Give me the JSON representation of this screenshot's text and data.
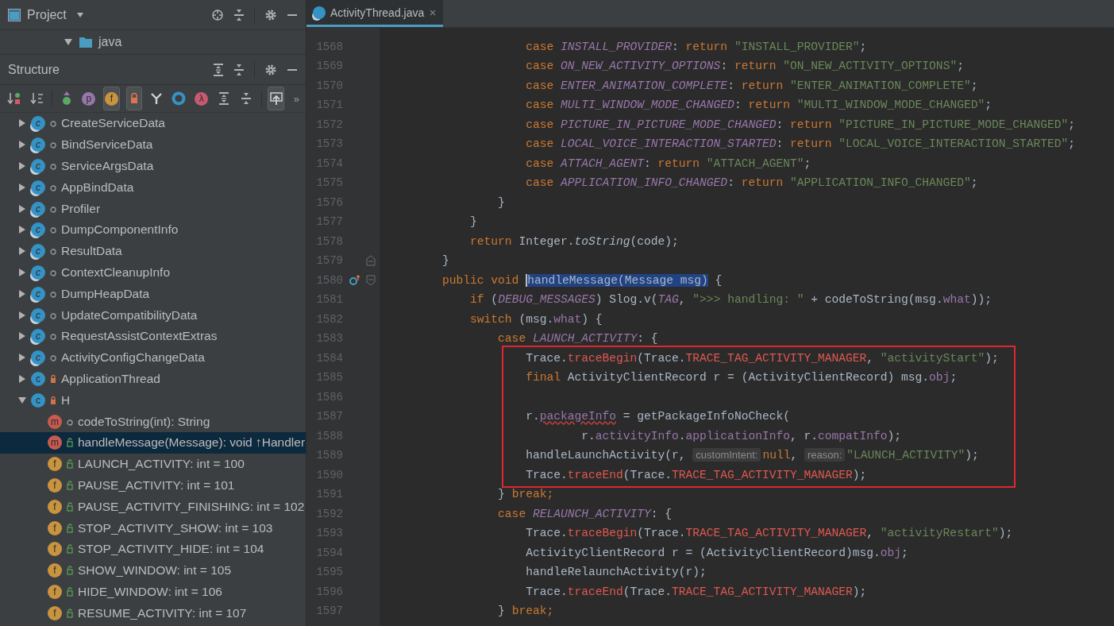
{
  "project_panel": {
    "title": "Project",
    "folder": {
      "label": "java",
      "expanded": true
    }
  },
  "structure_panel": {
    "title": "Structure",
    "overflow": "»",
    "toolbar": [
      {
        "kind": "sort-visibility",
        "on": false
      },
      {
        "kind": "sort-alpha",
        "on": false
      },
      {
        "kind": "inherited",
        "on": false
      },
      {
        "kind": "properties",
        "glyph": "p",
        "on": false
      },
      {
        "kind": "fields",
        "glyph": "f",
        "on": true
      },
      {
        "kind": "non-public",
        "on": true
      },
      {
        "kind": "filter",
        "on": false
      },
      {
        "kind": "anonymous",
        "on": false
      },
      {
        "kind": "lambda",
        "glyph": "λ",
        "on": false
      },
      {
        "kind": "expand",
        "on": false
      },
      {
        "kind": "collapse",
        "on": false
      },
      {
        "kind": "autoscroll",
        "on": true
      }
    ],
    "tree": [
      {
        "label": "CreateServiceData",
        "kind": "static-class",
        "glyph": "c",
        "private": false,
        "public": false,
        "expanded": false,
        "selected": false
      },
      {
        "label": "BindServiceData",
        "kind": "static-class",
        "glyph": "c",
        "private": false,
        "public": false,
        "expanded": false,
        "selected": false
      },
      {
        "label": "ServiceArgsData",
        "kind": "static-class",
        "glyph": "c",
        "private": false,
        "public": false,
        "expanded": false,
        "selected": false
      },
      {
        "label": "AppBindData",
        "kind": "static-class",
        "glyph": "c",
        "private": false,
        "public": false,
        "expanded": false,
        "selected": false
      },
      {
        "label": "Profiler",
        "kind": "static-class",
        "glyph": "c",
        "private": false,
        "public": false,
        "expanded": false,
        "selected": false
      },
      {
        "label": "DumpComponentInfo",
        "kind": "static-class",
        "glyph": "c",
        "private": false,
        "public": false,
        "expanded": false,
        "selected": false
      },
      {
        "label": "ResultData",
        "kind": "static-class",
        "glyph": "c",
        "private": false,
        "public": false,
        "expanded": false,
        "selected": false
      },
      {
        "label": "ContextCleanupInfo",
        "kind": "static-class",
        "glyph": "c",
        "private": false,
        "public": false,
        "expanded": false,
        "selected": false
      },
      {
        "label": "DumpHeapData",
        "kind": "static-class",
        "glyph": "c",
        "private": false,
        "public": false,
        "expanded": false,
        "selected": false
      },
      {
        "label": "UpdateCompatibilityData",
        "kind": "static-class",
        "glyph": "c",
        "private": false,
        "public": false,
        "expanded": false,
        "selected": false
      },
      {
        "label": "RequestAssistContextExtras",
        "kind": "static-class",
        "glyph": "c",
        "private": false,
        "public": false,
        "expanded": false,
        "selected": false
      },
      {
        "label": "ActivityConfigChangeData",
        "kind": "static-class",
        "glyph": "c",
        "private": false,
        "public": false,
        "expanded": false,
        "selected": false
      },
      {
        "label": "ApplicationThread",
        "kind": "class",
        "glyph": "c",
        "private": true,
        "public": false,
        "expanded": false,
        "selected": false
      },
      {
        "label": "H",
        "kind": "class",
        "glyph": "c",
        "private": true,
        "public": false,
        "expanded": true,
        "selected": false,
        "children": [
          {
            "label": "codeToString(int): String",
            "kind": "method",
            "glyph": "m",
            "private": false,
            "public": false,
            "selected": false
          },
          {
            "label": "handleMessage(Message): void ↑Handler",
            "kind": "method",
            "glyph": "m",
            "private": false,
            "public": true,
            "selected": true
          },
          {
            "label": "LAUNCH_ACTIVITY: int = 100",
            "kind": "field",
            "glyph": "f",
            "private": false,
            "public": true,
            "selected": false
          },
          {
            "label": "PAUSE_ACTIVITY: int = 101",
            "kind": "field",
            "glyph": "f",
            "private": false,
            "public": true,
            "selected": false
          },
          {
            "label": "PAUSE_ACTIVITY_FINISHING: int = 102",
            "kind": "field",
            "glyph": "f",
            "private": false,
            "public": true,
            "selected": false
          },
          {
            "label": "STOP_ACTIVITY_SHOW: int = 103",
            "kind": "field",
            "glyph": "f",
            "private": false,
            "public": true,
            "selected": false
          },
          {
            "label": "STOP_ACTIVITY_HIDE: int = 104",
            "kind": "field",
            "glyph": "f",
            "private": false,
            "public": true,
            "selected": false
          },
          {
            "label": "SHOW_WINDOW: int = 105",
            "kind": "field",
            "glyph": "f",
            "private": false,
            "public": true,
            "selected": false
          },
          {
            "label": "HIDE_WINDOW: int = 106",
            "kind": "field",
            "glyph": "f",
            "private": false,
            "public": true,
            "selected": false
          },
          {
            "label": "RESUME_ACTIVITY: int = 107",
            "kind": "field",
            "glyph": "f",
            "private": false,
            "public": true,
            "selected": false
          }
        ]
      }
    ]
  },
  "editor": {
    "tabs": [
      {
        "label": "ActivityThread.java",
        "selected": true
      }
    ],
    "segments": [
      {
        "boxed": false,
        "lines": [
          {
            "number": "1568",
            "kind": "code",
            "tokens": [
              {
                "kind": "kw",
                "text": "                    case "
              },
              {
                "kind": "const",
                "text": "INSTALL_PROVIDER"
              },
              {
                "kind": "text",
                "text": ": "
              },
              {
                "kind": "kw",
                "text": "return "
              },
              {
                "kind": "str",
                "text": "\"INSTALL_PROVIDER\""
              },
              {
                "kind": "text",
                "text": ";"
              }
            ]
          },
          {
            "number": "1569",
            "kind": "code",
            "tokens": [
              {
                "kind": "kw",
                "text": "                    case "
              },
              {
                "kind": "const",
                "text": "ON_NEW_ACTIVITY_OPTIONS"
              },
              {
                "kind": "text",
                "text": ": "
              },
              {
                "kind": "kw",
                "text": "return "
              },
              {
                "kind": "str",
                "text": "\"ON_NEW_ACTIVITY_OPTIONS\""
              },
              {
                "kind": "text",
                "text": ";"
              }
            ]
          },
          {
            "number": "1570",
            "kind": "code",
            "tokens": [
              {
                "kind": "kw",
                "text": "                    case "
              },
              {
                "kind": "const",
                "text": "ENTER_ANIMATION_COMPLETE"
              },
              {
                "kind": "text",
                "text": ": "
              },
              {
                "kind": "kw",
                "text": "return "
              },
              {
                "kind": "str",
                "text": "\"ENTER_ANIMATION_COMPLETE\""
              },
              {
                "kind": "text",
                "text": ";"
              }
            ]
          },
          {
            "number": "1571",
            "kind": "code",
            "tokens": [
              {
                "kind": "kw",
                "text": "                    case "
              },
              {
                "kind": "const",
                "text": "MULTI_WINDOW_MODE_CHANGED"
              },
              {
                "kind": "text",
                "text": ": "
              },
              {
                "kind": "kw",
                "text": "return "
              },
              {
                "kind": "str",
                "text": "\"MULTI_WINDOW_MODE_CHANGED\""
              },
              {
                "kind": "text",
                "text": ";"
              }
            ]
          },
          {
            "number": "1572",
            "kind": "code",
            "tokens": [
              {
                "kind": "kw",
                "text": "                    case "
              },
              {
                "kind": "const",
                "text": "PICTURE_IN_PICTURE_MODE_CHANGED"
              },
              {
                "kind": "text",
                "text": ": "
              },
              {
                "kind": "kw",
                "text": "return "
              },
              {
                "kind": "str",
                "text": "\"PICTURE_IN_PICTURE_MODE_CHANGED\""
              },
              {
                "kind": "text",
                "text": ";"
              }
            ]
          },
          {
            "number": "1573",
            "kind": "code",
            "tokens": [
              {
                "kind": "kw",
                "text": "                    case "
              },
              {
                "kind": "const",
                "text": "LOCAL_VOICE_INTERACTION_STARTED"
              },
              {
                "kind": "text",
                "text": ": "
              },
              {
                "kind": "kw",
                "text": "return "
              },
              {
                "kind": "str",
                "text": "\"LOCAL_VOICE_INTERACTION_STARTED\""
              },
              {
                "kind": "text",
                "text": ";"
              }
            ]
          },
          {
            "number": "1574",
            "kind": "code",
            "tokens": [
              {
                "kind": "kw",
                "text": "                    case "
              },
              {
                "kind": "const",
                "text": "ATTACH_AGENT"
              },
              {
                "kind": "text",
                "text": ": "
              },
              {
                "kind": "kw",
                "text": "return "
              },
              {
                "kind": "str",
                "text": "\"ATTACH_AGENT\""
              },
              {
                "kind": "text",
                "text": ";"
              }
            ]
          },
          {
            "number": "1575",
            "kind": "code",
            "tokens": [
              {
                "kind": "kw",
                "text": "                    case "
              },
              {
                "kind": "const",
                "text": "APPLICATION_INFO_CHANGED"
              },
              {
                "kind": "text",
                "text": ": "
              },
              {
                "kind": "kw",
                "text": "return "
              },
              {
                "kind": "str",
                "text": "\"APPLICATION_INFO_CHANGED\""
              },
              {
                "kind": "text",
                "text": ";"
              }
            ]
          },
          {
            "number": "1576",
            "kind": "code",
            "tokens": [
              {
                "kind": "text",
                "text": "                }"
              }
            ]
          },
          {
            "number": "1577",
            "kind": "code",
            "tokens": [
              {
                "kind": "text",
                "text": "            }"
              }
            ]
          },
          {
            "number": "1578",
            "kind": "code",
            "tokens": [
              {
                "kind": "kw",
                "text": "            return "
              },
              {
                "kind": "text",
                "text": "Integer."
              },
              {
                "kind": "static",
                "text": "toString"
              },
              {
                "kind": "text",
                "text": "(code);"
              }
            ]
          },
          {
            "number": "1579",
            "kind": "block-end",
            "tokens": [
              {
                "kind": "text",
                "text": "        }"
              }
            ]
          },
          {
            "number": "1580",
            "kind": "method-header",
            "tokens": [
              {
                "kind": "kw",
                "text": "        public void "
              },
              {
                "kind": "selected",
                "text": "handleMessage(Message msg)"
              },
              {
                "kind": "text",
                "text": " {"
              }
            ]
          },
          {
            "number": "1581",
            "kind": "code",
            "tokens": [
              {
                "kind": "kw",
                "text": "            if "
              },
              {
                "kind": "text",
                "text": "("
              },
              {
                "kind": "const",
                "text": "DEBUG_MESSAGES"
              },
              {
                "kind": "text",
                "text": ") Slog.v("
              },
              {
                "kind": "const",
                "text": "TAG"
              },
              {
                "kind": "text",
                "text": ", "
              },
              {
                "kind": "str",
                "text": "\">>> handling: \""
              },
              {
                "kind": "text",
                "text": " + codeToString(msg."
              },
              {
                "kind": "field",
                "text": "what"
              },
              {
                "kind": "text",
                "text": "));"
              }
            ]
          },
          {
            "number": "1582",
            "kind": "code",
            "tokens": [
              {
                "kind": "kw",
                "text": "            switch "
              },
              {
                "kind": "text",
                "text": "(msg."
              },
              {
                "kind": "field",
                "text": "what"
              },
              {
                "kind": "text",
                "text": ") {"
              }
            ]
          },
          {
            "number": "1583",
            "kind": "code",
            "tokens": [
              {
                "kind": "kw",
                "text": "                case "
              },
              {
                "kind": "const",
                "text": "LAUNCH_ACTIVITY"
              },
              {
                "kind": "text",
                "text": ": {"
              }
            ]
          }
        ]
      },
      {
        "boxed": true,
        "lines": [
          {
            "number": "1584",
            "kind": "code",
            "tokens": [
              {
                "kind": "text",
                "text": "                    Trace."
              },
              {
                "kind": "trace",
                "text": "traceBegin"
              },
              {
                "kind": "text",
                "text": "(Trace."
              },
              {
                "kind": "trace",
                "text": "TRACE_TAG_ACTIVITY_MANAGER"
              },
              {
                "kind": "text",
                "text": ", "
              },
              {
                "kind": "str",
                "text": "\"activityStart\""
              },
              {
                "kind": "text",
                "text": ");"
              }
            ]
          },
          {
            "number": "1585",
            "kind": "code",
            "tokens": [
              {
                "kind": "kw",
                "text": "                    final "
              },
              {
                "kind": "text",
                "text": "ActivityClientRecord r = (ActivityClientRecord) msg."
              },
              {
                "kind": "field",
                "text": "obj"
              },
              {
                "kind": "text",
                "text": ";"
              }
            ]
          },
          {
            "number": "1586",
            "kind": "code"
          },
          {
            "number": "1587",
            "kind": "code",
            "tokens": [
              {
                "kind": "text",
                "text": "                    r."
              },
              {
                "kind": "warn",
                "text": "packageInfo"
              },
              {
                "kind": "text",
                "text": " = getPackageInfoNoCheck("
              }
            ]
          },
          {
            "number": "1588",
            "kind": "code",
            "tokens": [
              {
                "kind": "text",
                "text": "                            r."
              },
              {
                "kind": "field",
                "text": "activityInfo"
              },
              {
                "kind": "text",
                "text": "."
              },
              {
                "kind": "field",
                "text": "applicationInfo"
              },
              {
                "kind": "text",
                "text": ", r."
              },
              {
                "kind": "field",
                "text": "compatInfo"
              },
              {
                "kind": "text",
                "text": ");"
              }
            ]
          },
          {
            "number": "1589",
            "kind": "code",
            "tokens": [
              {
                "kind": "text",
                "text": "                    handleLaunchActivity(r, "
              },
              {
                "kind": "hint",
                "text": "customIntent:"
              },
              {
                "kind": "kw",
                "text": "null"
              },
              {
                "kind": "text",
                "text": ", "
              },
              {
                "kind": "hint",
                "text": "reason:"
              },
              {
                "kind": "str",
                "text": "\"LAUNCH_ACTIVITY\""
              },
              {
                "kind": "text",
                "text": ");"
              }
            ]
          },
          {
            "number": "1590",
            "kind": "code",
            "tokens": [
              {
                "kind": "text",
                "text": "                    Trace."
              },
              {
                "kind": "trace",
                "text": "traceEnd"
              },
              {
                "kind": "text",
                "text": "(Trace."
              },
              {
                "kind": "trace",
                "text": "TRACE_TAG_ACTIVITY_MANAGER"
              },
              {
                "kind": "text",
                "text": ");"
              }
            ]
          }
        ]
      },
      {
        "boxed": false,
        "lines": [
          {
            "number": "1591",
            "kind": "code",
            "tokens": [
              {
                "kind": "text",
                "text": "                } "
              },
              {
                "kind": "kw",
                "text": "break;"
              }
            ]
          },
          {
            "number": "1592",
            "kind": "code",
            "tokens": [
              {
                "kind": "kw",
                "text": "                case "
              },
              {
                "kind": "const",
                "text": "RELAUNCH_ACTIVITY"
              },
              {
                "kind": "text",
                "text": ": {"
              }
            ]
          },
          {
            "number": "1593",
            "kind": "code",
            "tokens": [
              {
                "kind": "text",
                "text": "                    Trace."
              },
              {
                "kind": "trace",
                "text": "traceBegin"
              },
              {
                "kind": "text",
                "text": "(Trace."
              },
              {
                "kind": "trace",
                "text": "TRACE_TAG_ACTIVITY_MANAGER"
              },
              {
                "kind": "text",
                "text": ", "
              },
              {
                "kind": "str",
                "text": "\"activityRestart\""
              },
              {
                "kind": "text",
                "text": ");"
              }
            ]
          },
          {
            "number": "1594",
            "kind": "code",
            "tokens": [
              {
                "kind": "text",
                "text": "                    ActivityClientRecord r = (ActivityClientRecord)msg."
              },
              {
                "kind": "field",
                "text": "obj"
              },
              {
                "kind": "text",
                "text": ";"
              }
            ]
          },
          {
            "number": "1595",
            "kind": "code",
            "tokens": [
              {
                "kind": "text",
                "text": "                    handleRelaunchActivity(r);"
              }
            ]
          },
          {
            "number": "1596",
            "kind": "code",
            "tokens": [
              {
                "kind": "text",
                "text": "                    Trace."
              },
              {
                "kind": "trace",
                "text": "traceEnd"
              },
              {
                "kind": "text",
                "text": "(Trace."
              },
              {
                "kind": "trace",
                "text": "TRACE_TAG_ACTIVITY_MANAGER"
              },
              {
                "kind": "text",
                "text": ");"
              }
            ]
          },
          {
            "number": "1597",
            "kind": "code",
            "tokens": [
              {
                "kind": "text",
                "text": "                } "
              },
              {
                "kind": "kw",
                "text": "break;"
              }
            ]
          }
        ]
      }
    ]
  }
}
